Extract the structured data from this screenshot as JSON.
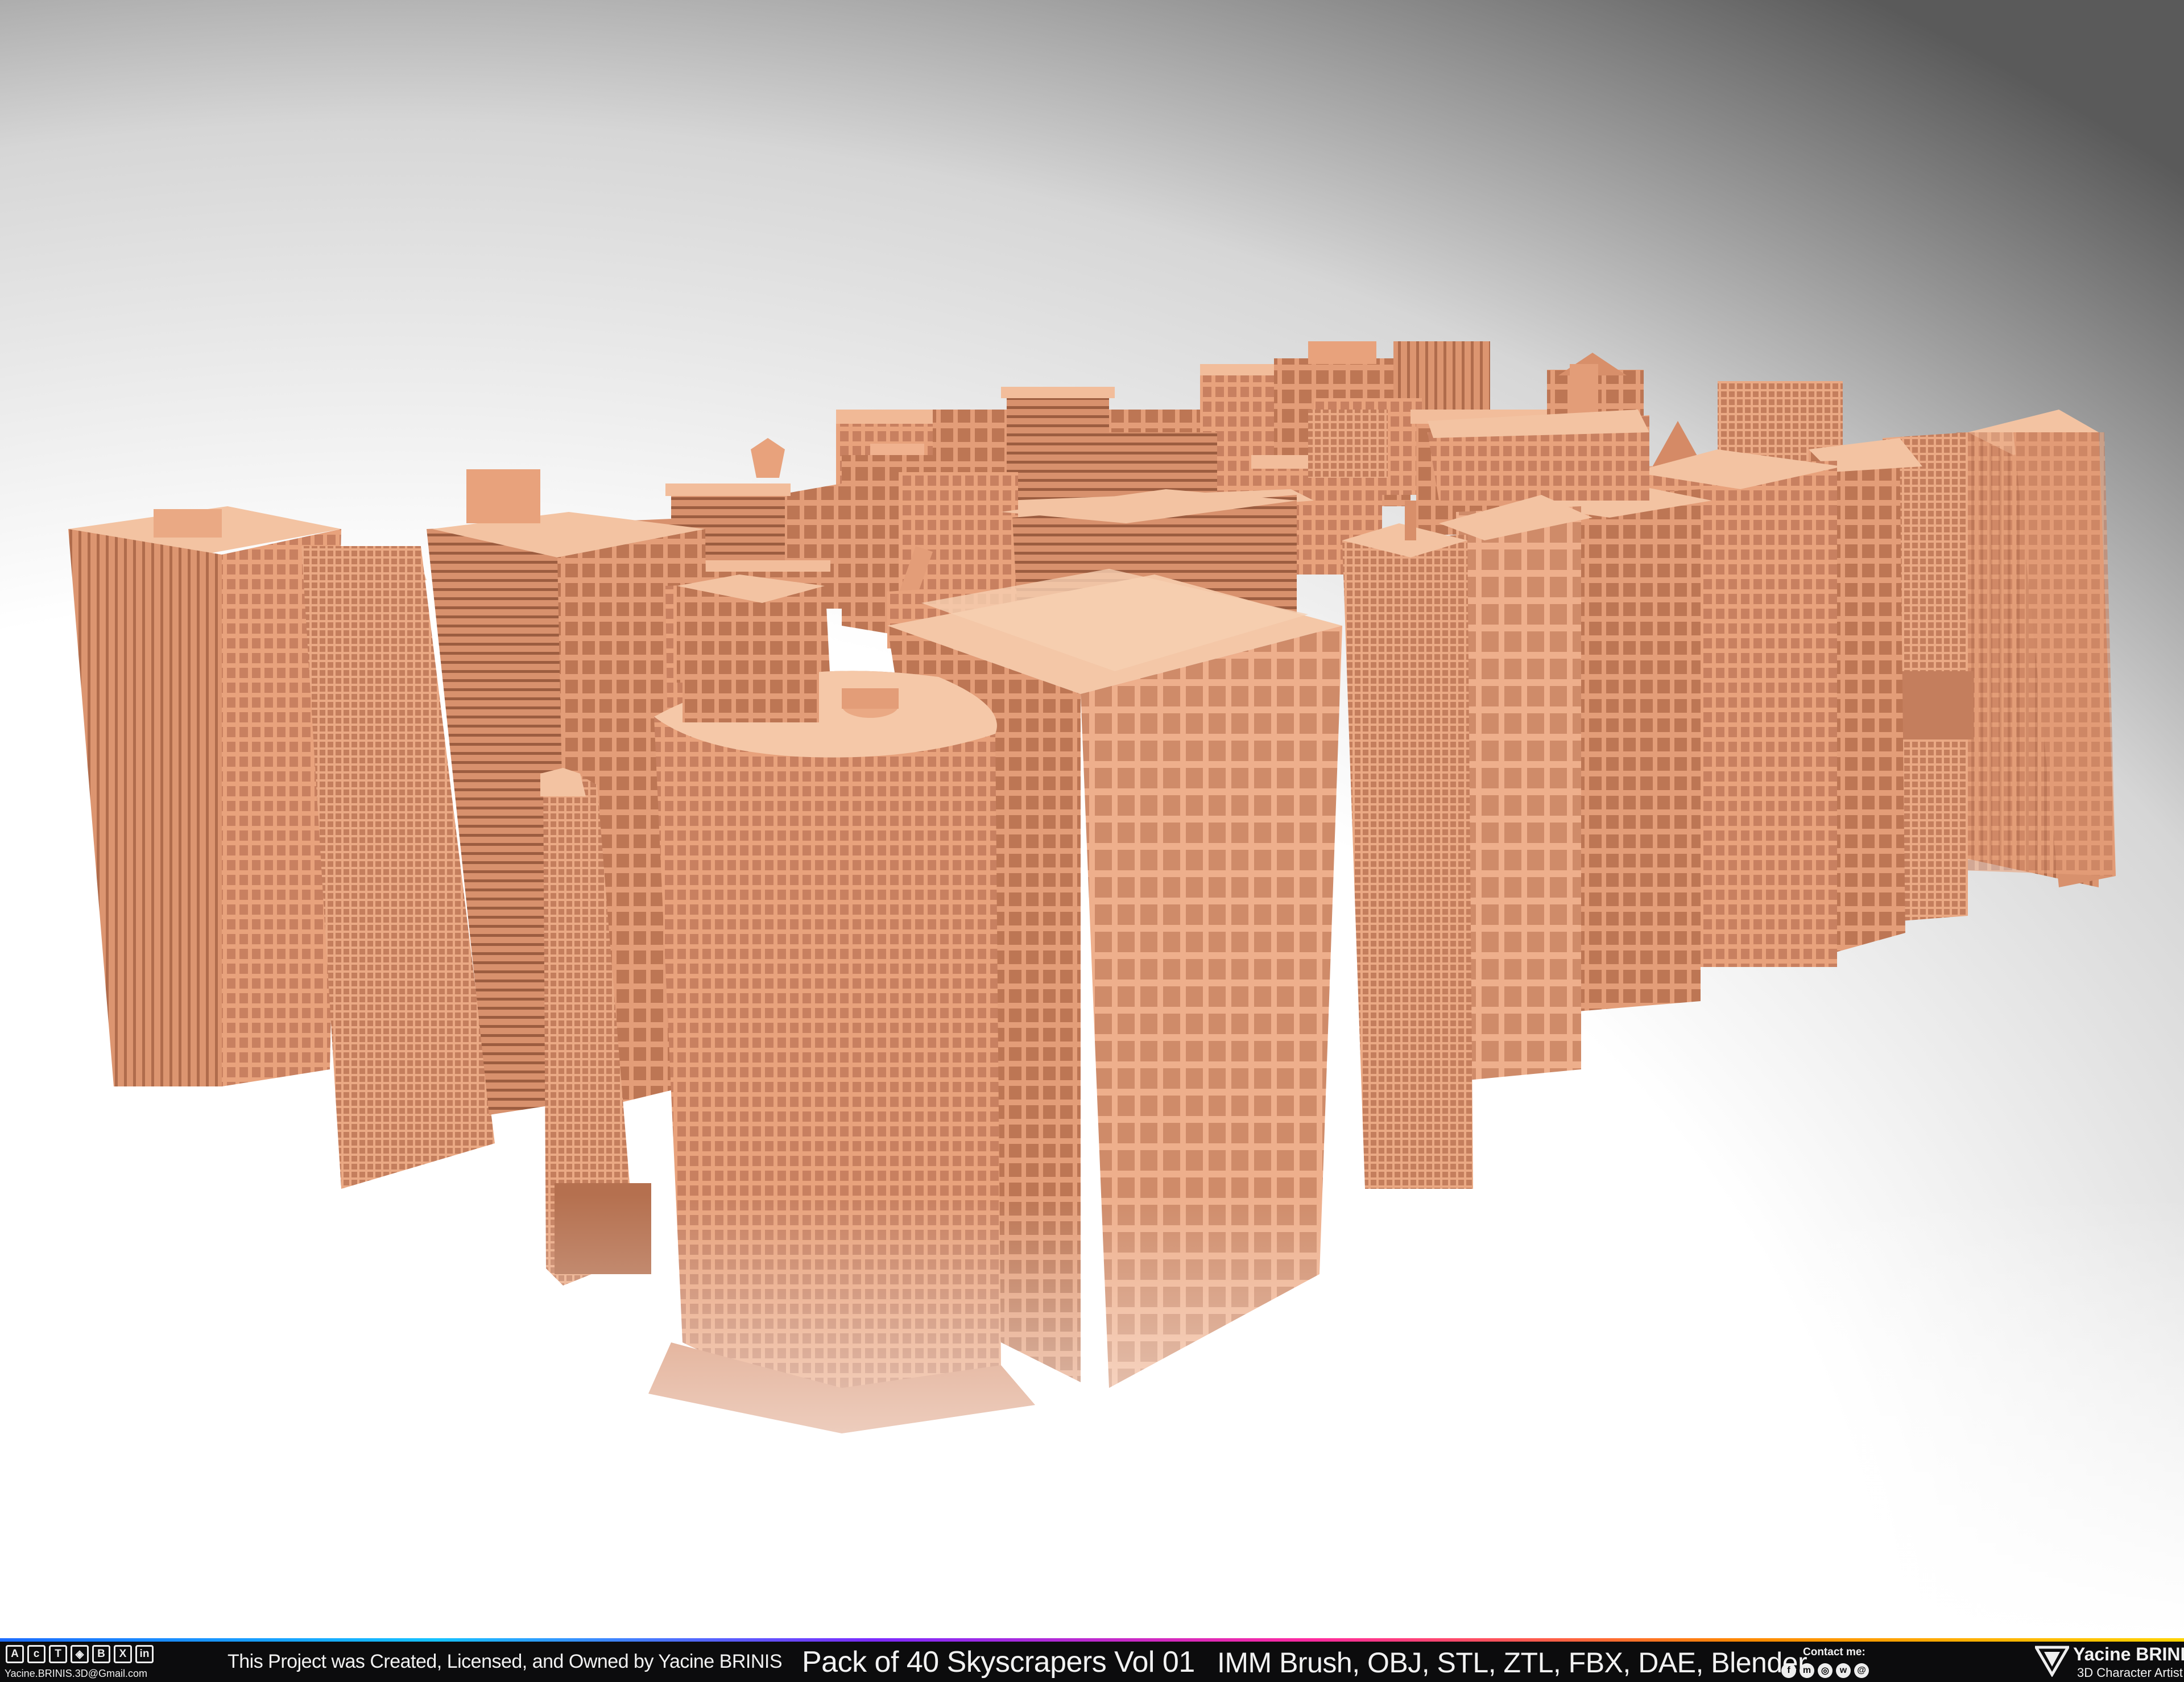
{
  "footer": {
    "email": "Yacine.BRINIS.3D@Gmail.com",
    "ownership": "This Project was Created, Licensed, and Owned by Yacine BRINIS",
    "title": "Pack of 40 Skyscrapers Vol 01",
    "formats": "IMM Brush, OBJ, STL, ZTL, FBX, DAE, Blender",
    "contact_label": "Contact me:",
    "author_name": "Yacine BRINIS",
    "author_role": "3D Character Artist",
    "social_icons": [
      "artstation-icon",
      "cgtrader-icon",
      "turbosquid-icon",
      "sketchfab-icon",
      "behance-icon",
      "x-icon",
      "linkedin-icon"
    ],
    "contact_icons": [
      "facebook-icon",
      "messenger-icon",
      "instagram-icon",
      "whatsapp-icon",
      "email-icon"
    ]
  },
  "colors": {
    "building_light": "#eeaf8c",
    "building_mid": "#d98f6b",
    "building_dark": "#b5704f",
    "footer_bg": "#0c0c0d"
  }
}
